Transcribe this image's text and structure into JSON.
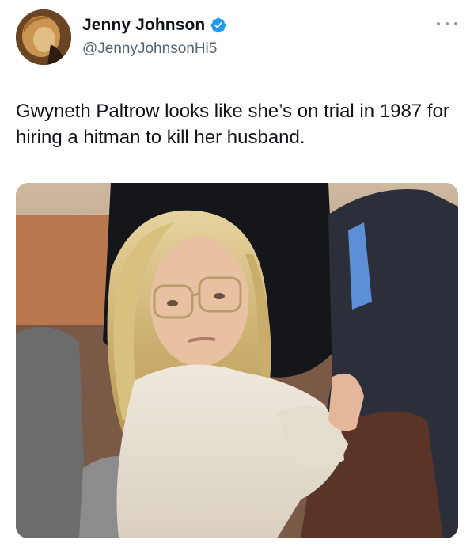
{
  "author": {
    "display_name": "Jenny Johnson",
    "handle": "@JennyJohnsonHi5",
    "verified": true,
    "avatar_icon": "user-avatar-photo"
  },
  "tweet": {
    "text": "Gwyneth Paltrow looks like she’s on trial in 1987 for hiring a hitman to kill her husband."
  },
  "media": {
    "type": "photo",
    "alt": "Photo of a blonde woman in glasses and a cream sweater seated in a courtroom"
  },
  "icons": {
    "verified": "verified-badge-icon",
    "more": "more-options-icon"
  },
  "colors": {
    "verified_blue": "#1d9bf0",
    "text_primary": "#0f1419",
    "text_secondary": "#536471"
  }
}
